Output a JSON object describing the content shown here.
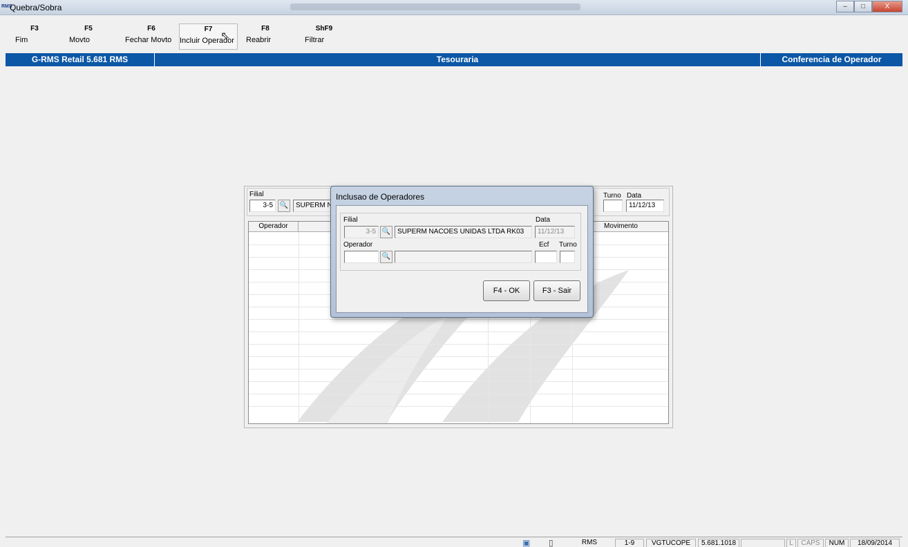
{
  "window": {
    "app_badge": "RMS",
    "title": "Quebra/Sobra",
    "buttons": {
      "minimize": "–",
      "maximize": "□",
      "close": "X"
    }
  },
  "toolbar": {
    "items": [
      {
        "key": "F3",
        "label": "Fim"
      },
      {
        "key": "F5",
        "label": "Movto"
      },
      {
        "key": "F6",
        "label": "Fechar Movto"
      },
      {
        "key": "F7",
        "label": "Incluir Operador"
      },
      {
        "key": "F8",
        "label": "Reabrir"
      },
      {
        "key": "ShF9",
        "label": "Filtrar"
      }
    ]
  },
  "infobar": {
    "left": "G-RMS Retail 5.681 RMS",
    "center": "Tesouraria",
    "right": "Conferencia de Operador"
  },
  "background_form": {
    "filial_label": "Filial",
    "filial_code": "3-5",
    "filial_name": "SUPERM N",
    "turno_label": "Turno",
    "data_label": "Data",
    "turno_value": "",
    "data_value": "11/12/13",
    "grid_headers": {
      "operador": "Operador",
      "movimento": "Movimento"
    }
  },
  "dialog": {
    "title": "Inclusao de Operadores",
    "filial_label": "Filial",
    "filial_code": "3-5",
    "filial_name": "SUPERM NACOES UNIDAS LTDA RK03",
    "data_label": "Data",
    "data_value": "11/12/13",
    "operador_label": "Operador",
    "operador_code": "",
    "operador_name": "",
    "ecf_label": "Ecf",
    "turno_label": "Turno",
    "ecf_value": "",
    "turno_value": "",
    "ok_label": "F4 - OK",
    "exit_label": "F3 - Sair"
  },
  "statusbar": {
    "system": "RMS",
    "range": "1-9",
    "program": "VGTUCOPE",
    "version": "5.681.1018",
    "empty": "",
    "l": "L",
    "caps": "CAPS",
    "num": "NUM",
    "date": "18/09/2014"
  },
  "icons": {
    "search": "binoculars-icon",
    "cursor": "mouse-cursor-icon"
  }
}
